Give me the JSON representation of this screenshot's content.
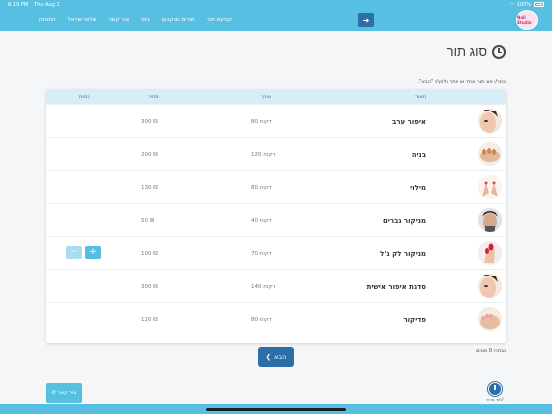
{
  "status": {
    "time": "6:19 PM",
    "date": "Thu Aug 1",
    "battery": "100%"
  },
  "nav": {
    "logo_text": "Nail Studio",
    "logout_icon": "arrow-right-icon",
    "items": [
      "קביעת תור",
      "תורים שנקבעו",
      "גיוס",
      "צור קשר",
      "שלום ישראל",
      "התנתק"
    ]
  },
  "page": {
    "title": "סוג תור",
    "instruction": "בחר/י סוג תור אחד או יותר ולחץ/י \"הבא\".",
    "selected_count": "נבחרו 0 סוגים",
    "next_label": "הבא",
    "contact_label": "צור קשר",
    "myturns_label": "תור מהיר?"
  },
  "table": {
    "headers": {
      "desc": "תאור",
      "duration": "אורך",
      "price": "מחיר",
      "qty": "כמות"
    },
    "rows": [
      {
        "name": "איפור ערב",
        "duration": "80 דקות",
        "price": "300 ₪",
        "thumb": "face"
      },
      {
        "name": "בניה",
        "duration": "120 דקות",
        "price": "200 ₪",
        "thumb": "nails"
      },
      {
        "name": "מילוי",
        "duration": "80 דקות",
        "price": "130 ₪",
        "thumb": "hands"
      },
      {
        "name": "מניקור גברים",
        "duration": "40 דקות",
        "price": "50 ₪",
        "thumb": "man"
      },
      {
        "name": "מניקור לק ג'ל",
        "duration": "70 דקות",
        "price": "100 ₪",
        "thumb": "redhand"
      },
      {
        "name": "סדנת איפור אישית",
        "duration": "140 דקות",
        "price": "300 ₪",
        "thumb": "face"
      },
      {
        "name": "פדיקור",
        "duration": "80 דקות",
        "price": "120 ₪",
        "thumb": "feet"
      }
    ],
    "qty": {
      "minus": "−",
      "plus": "+"
    }
  },
  "colors": {
    "bar": "#57c0e2",
    "primary": "#2c6fa8",
    "header": "#d8eef7"
  }
}
